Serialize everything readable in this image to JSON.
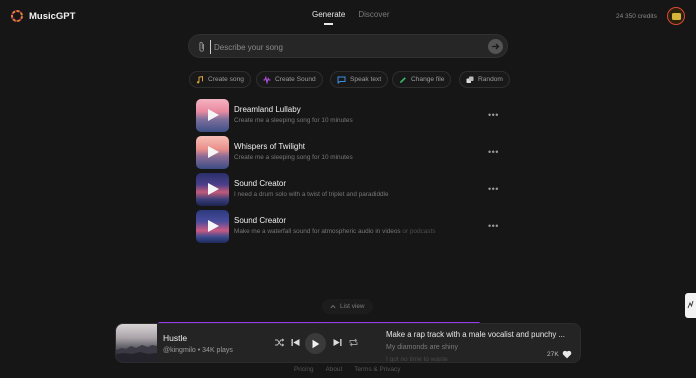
{
  "app": {
    "name": "MusicGPT",
    "credits": "24 350 credits"
  },
  "tabs": [
    {
      "label": "Generate",
      "active": true
    },
    {
      "label": "Discover",
      "active": false
    }
  ],
  "prompt": {
    "placeholder": "Describe your song",
    "value": ""
  },
  "chips": [
    {
      "label": "Create song",
      "icon": "music-note-icon",
      "color": "#d9a23a"
    },
    {
      "label": "Create Sound",
      "icon": "sound-wave-icon",
      "color": "#b04fe0"
    },
    {
      "label": "Speak text",
      "icon": "speech-bubble-icon",
      "color": "#3a8fe0"
    },
    {
      "label": "Change file",
      "icon": "pencil-icon",
      "color": "#39b86a"
    },
    {
      "label": "Random",
      "icon": "dice-icon",
      "color": "#dddddd"
    }
  ],
  "songs": [
    {
      "title": "Dreamland Lullaby",
      "desc": "Create me a sleeping song for 10 minutes",
      "desc_dim": ""
    },
    {
      "title": "Whispers of Twilight",
      "desc": "Create me a sleeping song for 10 minutes",
      "desc_dim": ""
    },
    {
      "title": "Sound Creator",
      "desc": "I need a drum solo with a twist of triplet and paradiddle",
      "desc_dim": ""
    },
    {
      "title": "Sound Creator",
      "desc": "Make me a waterfall sound for atmospheric audio in videos",
      "desc_dim": "or podcasts"
    }
  ],
  "list_view_label": "List view",
  "player": {
    "title": "Hustle",
    "artist": "@kingmilo",
    "plays": "34K plays",
    "separator": "•",
    "prompt_text": "Make a rap track with a male vocalist and punchy ...",
    "lyric_line": "My diamonds are shiny",
    "lyric_next": "I got no time to waste",
    "likes": "27K",
    "progress_fraction": 0.69,
    "accent": "#9a3af0"
  },
  "footer": [
    "Pricing",
    "About",
    "Terms & Privacy"
  ]
}
